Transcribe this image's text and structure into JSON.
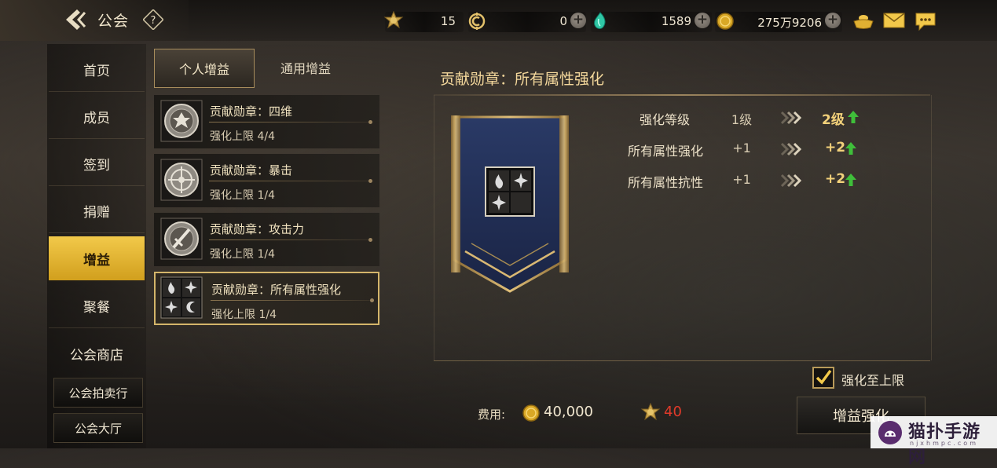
{
  "header": {
    "title": "公会",
    "resources": [
      {
        "name": "medal",
        "value": "15",
        "has_plus": false
      },
      {
        "name": "guild-coin",
        "value": "0",
        "has_plus": true
      },
      {
        "name": "gem",
        "value": "1589",
        "has_plus": true
      },
      {
        "name": "gold",
        "value": "275万9206",
        "has_plus": true
      }
    ],
    "icons": [
      "ingot-icon",
      "mail-icon",
      "chat-icon"
    ]
  },
  "nav": {
    "items": [
      "首页",
      "成员",
      "签到",
      "捐赠",
      "增益",
      "聚餐",
      "公会商店"
    ],
    "active_index": 4,
    "sub_items": [
      "公会拍卖行",
      "公会大厅"
    ]
  },
  "tabs": {
    "personal": "个人增益",
    "general": "通用增益",
    "active": "personal"
  },
  "buff_list": [
    {
      "title": "贡献勋章：四维",
      "limit": "强化上限 4/4",
      "icon": "four-stats-medal-icon"
    },
    {
      "title": "贡献勋章：暴击",
      "limit": "强化上限 1/4",
      "icon": "crit-medal-icon"
    },
    {
      "title": "贡献勋章：攻击力",
      "limit": "强化上限 1/4",
      "icon": "attack-medal-icon"
    },
    {
      "title": "贡献勋章：所有属性强化",
      "limit": "强化上限 1/4",
      "icon": "all-element-medal-icon"
    }
  ],
  "selected_index": 3,
  "detail": {
    "title": "贡献勋章：所有属性强化",
    "stats": [
      {
        "label": "强化等级",
        "current": "1级",
        "next": "2级"
      },
      {
        "label": "所有属性强化",
        "current": "+1",
        "next": "+2"
      },
      {
        "label": "所有属性抗性",
        "current": "+1",
        "next": "+2"
      }
    ],
    "max_checkbox_label": "强化至上限",
    "max_checked": true,
    "cost_label": "费用:",
    "cost_gold": "40,000",
    "cost_medal": "40",
    "enhance_button": "增益强化"
  },
  "watermark": {
    "text": "猫扑手游网",
    "small": "njxhmpc.com"
  },
  "colors": {
    "accent_gold": "#e6b83a",
    "up_arrow": "#3fbf3a",
    "insufficient": "#e23a2a"
  }
}
